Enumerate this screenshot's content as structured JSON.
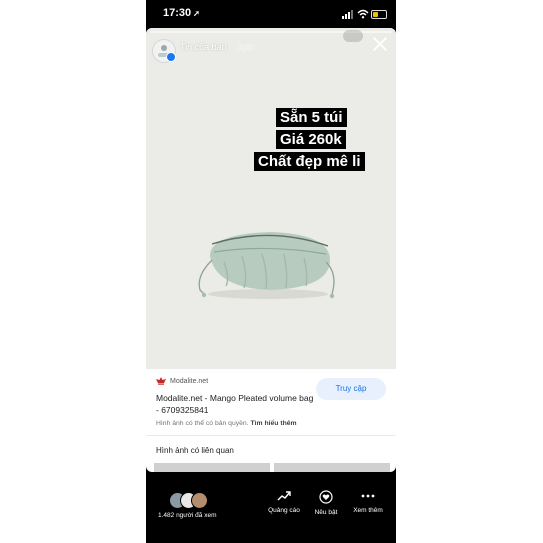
{
  "status_bar": {
    "time": "17:30",
    "location_arrow": "➚"
  },
  "story": {
    "author": "Tin của bạn",
    "time_ago": "3giờ",
    "caption_lines": [
      "Sẵn 5 túi",
      "Giá 260k",
      "Chất đẹp mê li"
    ]
  },
  "link_preview": {
    "site": "Modalite.net",
    "title": "Modalite.net - Mango Pleated volume bag - 6709325841",
    "button": "Truy cập",
    "copyright": "Hình ảnh có thể có bản quyền.",
    "learn_more": "Tìm hiểu thêm",
    "related": "Hình ảnh có liên quan"
  },
  "bottom_bar": {
    "viewers": "1.482 người đã xem",
    "actions": [
      "Quảng cáo",
      "Nêu bật",
      "Xem thêm"
    ]
  },
  "colors": {
    "link_blue": "#1a73e8",
    "button_bg": "#e8f0fe",
    "bag_mint": "#b7ccbf",
    "photo_bg": "#ebebe7"
  },
  "icons": [
    "location-arrow-icon",
    "signal-icon",
    "wifi-icon",
    "battery-icon",
    "close-icon",
    "verified-badge-icon",
    "site-logo-icon",
    "promote-icon",
    "highlight-icon",
    "more-icon"
  ]
}
